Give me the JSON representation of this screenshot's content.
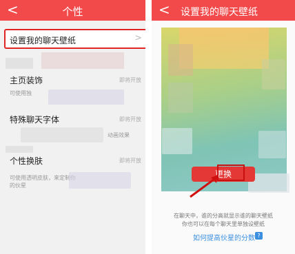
{
  "left": {
    "back_glyph": "<",
    "title": "个性",
    "highlight_item": "设置我的聊天壁纸",
    "chevron": ">",
    "items": [
      {
        "name": "主页装饰",
        "status": "即将开放",
        "desc": "可使用独"
      },
      {
        "name": "特殊聊天字体",
        "status": "即将开放",
        "desc": "动画效果"
      },
      {
        "name": "个性换肤",
        "status": "即将开放",
        "desc": "可使用透明皮肤，来定制你的伙星"
      }
    ]
  },
  "right": {
    "back_glyph": "<",
    "title": "设置我的聊天壁纸",
    "change_label": "更换",
    "tip_line1": "在聊天中，谁的分高就显示谁的聊天壁纸",
    "tip_line2": "你也可以在每个聊天里单独设壁纸",
    "link": "如何提高伙星的分数",
    "help_glyph": "?"
  },
  "colors": {
    "accent_red": "#f2494a",
    "link_blue": "#3a8fe0",
    "highlight_border": "#e02424"
  }
}
